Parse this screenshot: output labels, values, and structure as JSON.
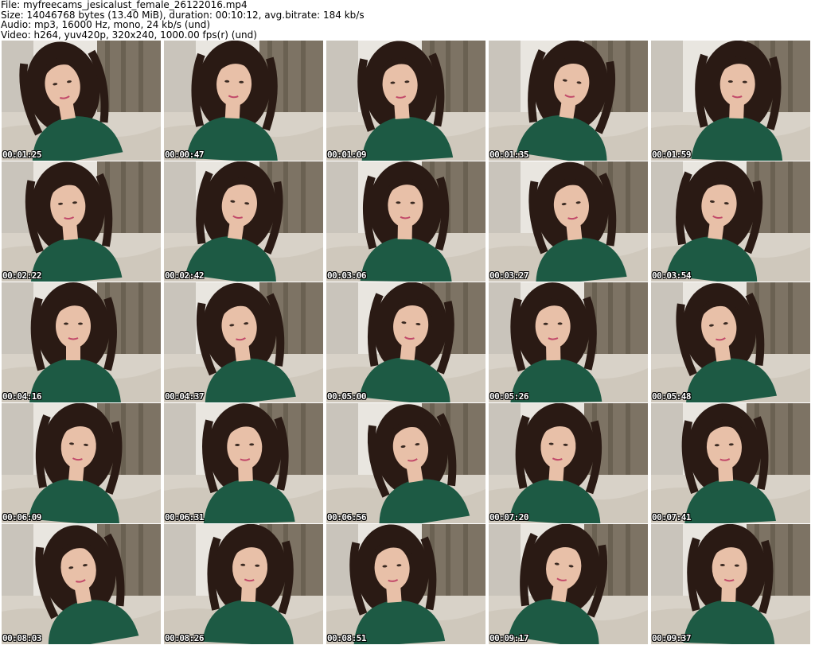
{
  "header": {
    "file_line": "File: myfreecams_jesicalust_female_26122016.mp4",
    "size_line": "Size: 14046768 bytes (13.40 MiB), duration: 00:10:12, avg.bitrate: 184 kb/s",
    "audio_line": "Audio: mp3, 16000 Hz, mono, 24 kb/s (und)",
    "video_line": "Video: h264, yuv420p, 320x240, 1000.00 fps(r) (und)"
  },
  "thumbnails": [
    {
      "timestamp": "00:01:25"
    },
    {
      "timestamp": "00:00:47"
    },
    {
      "timestamp": "00:01:09"
    },
    {
      "timestamp": "00:01:35"
    },
    {
      "timestamp": "00:01:59"
    },
    {
      "timestamp": "00:02:22"
    },
    {
      "timestamp": "00:02:42"
    },
    {
      "timestamp": "00:03:06"
    },
    {
      "timestamp": "00:03:27"
    },
    {
      "timestamp": "00:03:54"
    },
    {
      "timestamp": "00:04:16"
    },
    {
      "timestamp": "00:04:37"
    },
    {
      "timestamp": "00:05:00"
    },
    {
      "timestamp": "00:05:26"
    },
    {
      "timestamp": "00:05:48"
    },
    {
      "timestamp": "00:06:09"
    },
    {
      "timestamp": "00:06:31"
    },
    {
      "timestamp": "00:06:56"
    },
    {
      "timestamp": "00:07:20"
    },
    {
      "timestamp": "00:07:41"
    },
    {
      "timestamp": "00:08:03"
    },
    {
      "timestamp": "00:08:26"
    },
    {
      "timestamp": "00:08:51"
    },
    {
      "timestamp": "00:09:17"
    },
    {
      "timestamp": "00:09:37"
    }
  ],
  "colors": {
    "shirt": "#1d5a44",
    "hair": "#2a1a14",
    "skin": "#e8c0a8",
    "curtain": "#7d7364",
    "floor": "#d8d2c8",
    "wall": "#e9e6e0"
  }
}
